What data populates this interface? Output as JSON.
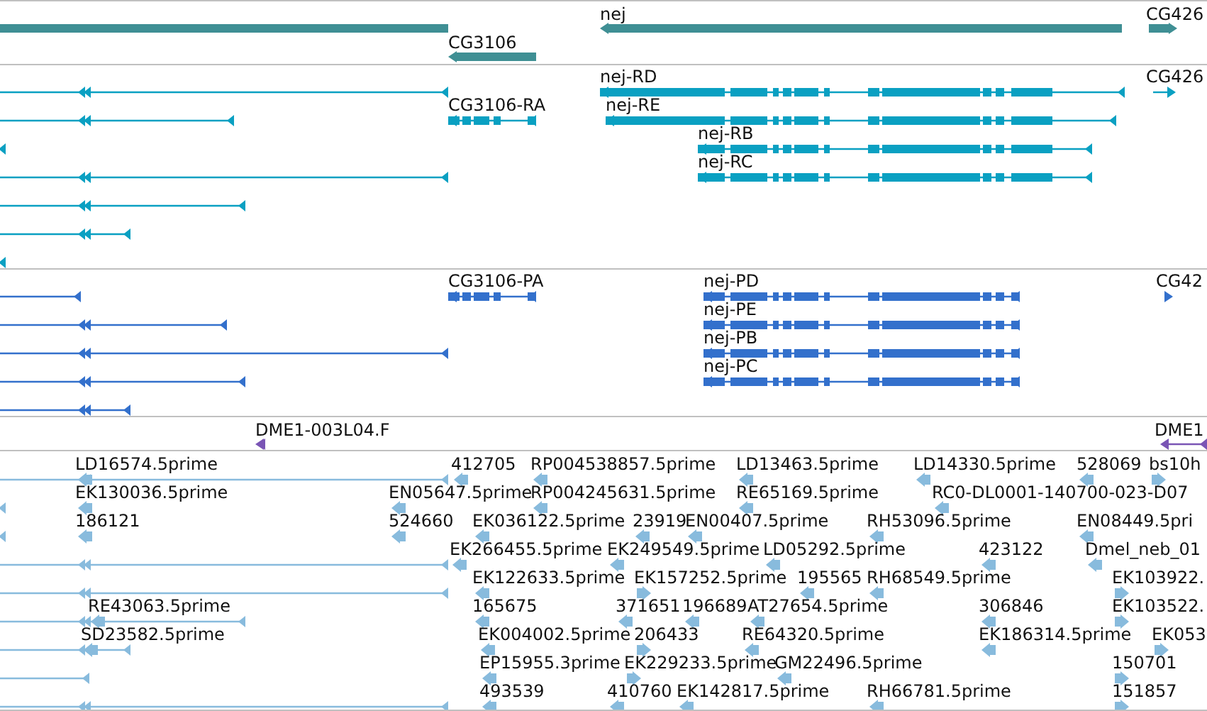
{
  "tracks": [
    {
      "kind": "gene",
      "features": [
        {
          "label": "CG3106",
          "reverse": true
        },
        {
          "label": "nej",
          "reverse": true
        },
        {
          "label": "CG426",
          "reverse": false
        }
      ]
    },
    {
      "kind": "transcript",
      "features": [
        {
          "label": "CG3106-RA",
          "reverse": true
        },
        {
          "label": "nej-RD",
          "reverse": true
        },
        {
          "label": "nej-RE",
          "reverse": true
        },
        {
          "label": "nej-RB",
          "reverse": true
        },
        {
          "label": "nej-RC",
          "reverse": true
        },
        {
          "label": "CG426",
          "reverse": false
        }
      ]
    },
    {
      "kind": "protein",
      "features": [
        {
          "label": "CG3106-PA",
          "reverse": true
        },
        {
          "label": "nej-PD",
          "reverse": true
        },
        {
          "label": "nej-PE",
          "reverse": true
        },
        {
          "label": "nej-PB",
          "reverse": true
        },
        {
          "label": "nej-PC",
          "reverse": true
        },
        {
          "label": "CG42",
          "reverse": false
        }
      ]
    },
    {
      "kind": "clone",
      "features": [
        {
          "label": "DME1-003L04.F",
          "reverse": true
        },
        {
          "label": "DME1",
          "reverse": true
        }
      ]
    },
    {
      "kind": "est",
      "features": [
        {
          "label": "LD16574.5prime",
          "reverse": true
        },
        {
          "label": "412705",
          "reverse": true
        },
        {
          "label": "RP004538857.5prime",
          "reverse": true
        },
        {
          "label": "LD13463.5prime",
          "reverse": true
        },
        {
          "label": "LD14330.5prime",
          "reverse": true
        },
        {
          "label": "528069",
          "reverse": true
        },
        {
          "label": "bs10h",
          "reverse": false
        },
        {
          "label": "EK130036.5prime",
          "reverse": true
        },
        {
          "label": "EN05647.5prime",
          "reverse": true
        },
        {
          "label": "RP004245631.5prime",
          "reverse": true
        },
        {
          "label": "RE65169.5prime",
          "reverse": true
        },
        {
          "label": "RC0-DL0001-140700-023-D07",
          "reverse": true
        },
        {
          "label": "186121",
          "reverse": true
        },
        {
          "label": "524660",
          "reverse": true
        },
        {
          "label": "EK036122.5prime",
          "reverse": true
        },
        {
          "label": "23919",
          "reverse": true
        },
        {
          "label": "EN00407.5prime",
          "reverse": true
        },
        {
          "label": "RH53096.5prime",
          "reverse": true
        },
        {
          "label": "EN08449.5pri",
          "reverse": true
        },
        {
          "label": "EK266455.5prime",
          "reverse": true
        },
        {
          "label": "EK249549.5prime",
          "reverse": true
        },
        {
          "label": "LD05292.5prime",
          "reverse": true
        },
        {
          "label": "423122",
          "reverse": true
        },
        {
          "label": "Dmel_neb_01",
          "reverse": true
        },
        {
          "label": "EK122633.5prime",
          "reverse": true
        },
        {
          "label": "EK157252.5prime",
          "reverse": false
        },
        {
          "label": "195565",
          "reverse": true
        },
        {
          "label": "RH68549.5prime",
          "reverse": true
        },
        {
          "label": "EK103922.",
          "reverse": false
        },
        {
          "label": "RE43063.5prime",
          "reverse": true
        },
        {
          "label": "165675",
          "reverse": true
        },
        {
          "label": "371651",
          "reverse": true
        },
        {
          "label": "196689",
          "reverse": true
        },
        {
          "label": "AT27654.5prime",
          "reverse": true
        },
        {
          "label": "306846",
          "reverse": true
        },
        {
          "label": "EK103522.",
          "reverse": false
        },
        {
          "label": "SD23582.5prime",
          "reverse": true
        },
        {
          "label": "EK004002.5prime",
          "reverse": true
        },
        {
          "label": "206433",
          "reverse": false
        },
        {
          "label": "RE64320.5prime",
          "reverse": true
        },
        {
          "label": "EK186314.5prime",
          "reverse": true
        },
        {
          "label": "EK053",
          "reverse": false
        },
        {
          "label": "EP15955.3prime",
          "reverse": true
        },
        {
          "label": "EK229233.5prime",
          "reverse": false
        },
        {
          "label": "GM22496.5prime",
          "reverse": true
        },
        {
          "label": "150701",
          "reverse": false
        },
        {
          "label": "493539",
          "reverse": true
        },
        {
          "label": "410760",
          "reverse": true
        },
        {
          "label": "EK142817.5prime",
          "reverse": true
        },
        {
          "label": "RH66781.5prime",
          "reverse": true
        },
        {
          "label": "151857",
          "reverse": false
        }
      ]
    }
  ]
}
